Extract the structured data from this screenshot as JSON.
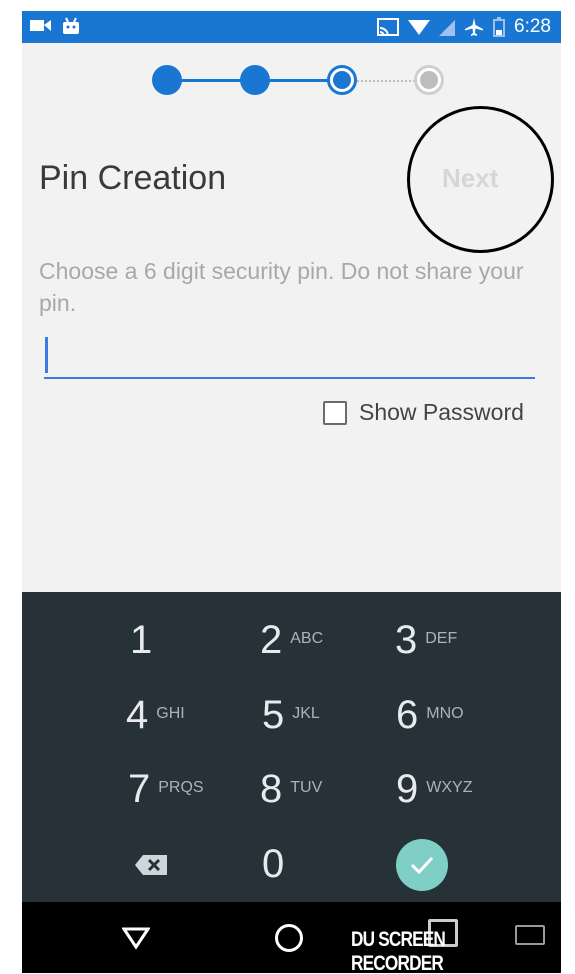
{
  "status_bar": {
    "time": "6:28",
    "left_icons": [
      "video-camera-icon",
      "android-icon"
    ],
    "right_icons": [
      "cast-icon",
      "wifi-icon",
      "no-sim-icon",
      "airplane-icon",
      "battery-icon"
    ]
  },
  "stepper": {
    "steps": [
      "done",
      "done",
      "active",
      "todo"
    ]
  },
  "header": {
    "title": "Pin Creation",
    "next_label": "Next"
  },
  "form": {
    "description": "Choose a 6 digit security pin. Do not share your pin.",
    "pin_value": "",
    "show_password_label": "Show Password",
    "show_password_checked": false
  },
  "keypad": {
    "keys": [
      {
        "digit": "1",
        "letters": ""
      },
      {
        "digit": "2",
        "letters": "ABC"
      },
      {
        "digit": "3",
        "letters": "DEF"
      },
      {
        "digit": "4",
        "letters": "GHI"
      },
      {
        "digit": "5",
        "letters": "JKL"
      },
      {
        "digit": "6",
        "letters": "MNO"
      },
      {
        "digit": "7",
        "letters": "PRQS"
      },
      {
        "digit": "8",
        "letters": "TUV"
      },
      {
        "digit": "9",
        "letters": "WXYZ"
      },
      {
        "digit": "0",
        "letters": ""
      }
    ],
    "delete_icon": "backspace-icon",
    "done_icon": "checkmark-icon"
  },
  "navbar": {
    "icons": [
      "back-triangle-icon",
      "home-circle-icon",
      "recent-apps-icon",
      "keyboard-icon"
    ],
    "watermark": "DU SCREEN RECORDER"
  },
  "colors": {
    "primary": "#1976d2",
    "keypad_bg": "#263238",
    "done_button": "#7fcfc6"
  }
}
